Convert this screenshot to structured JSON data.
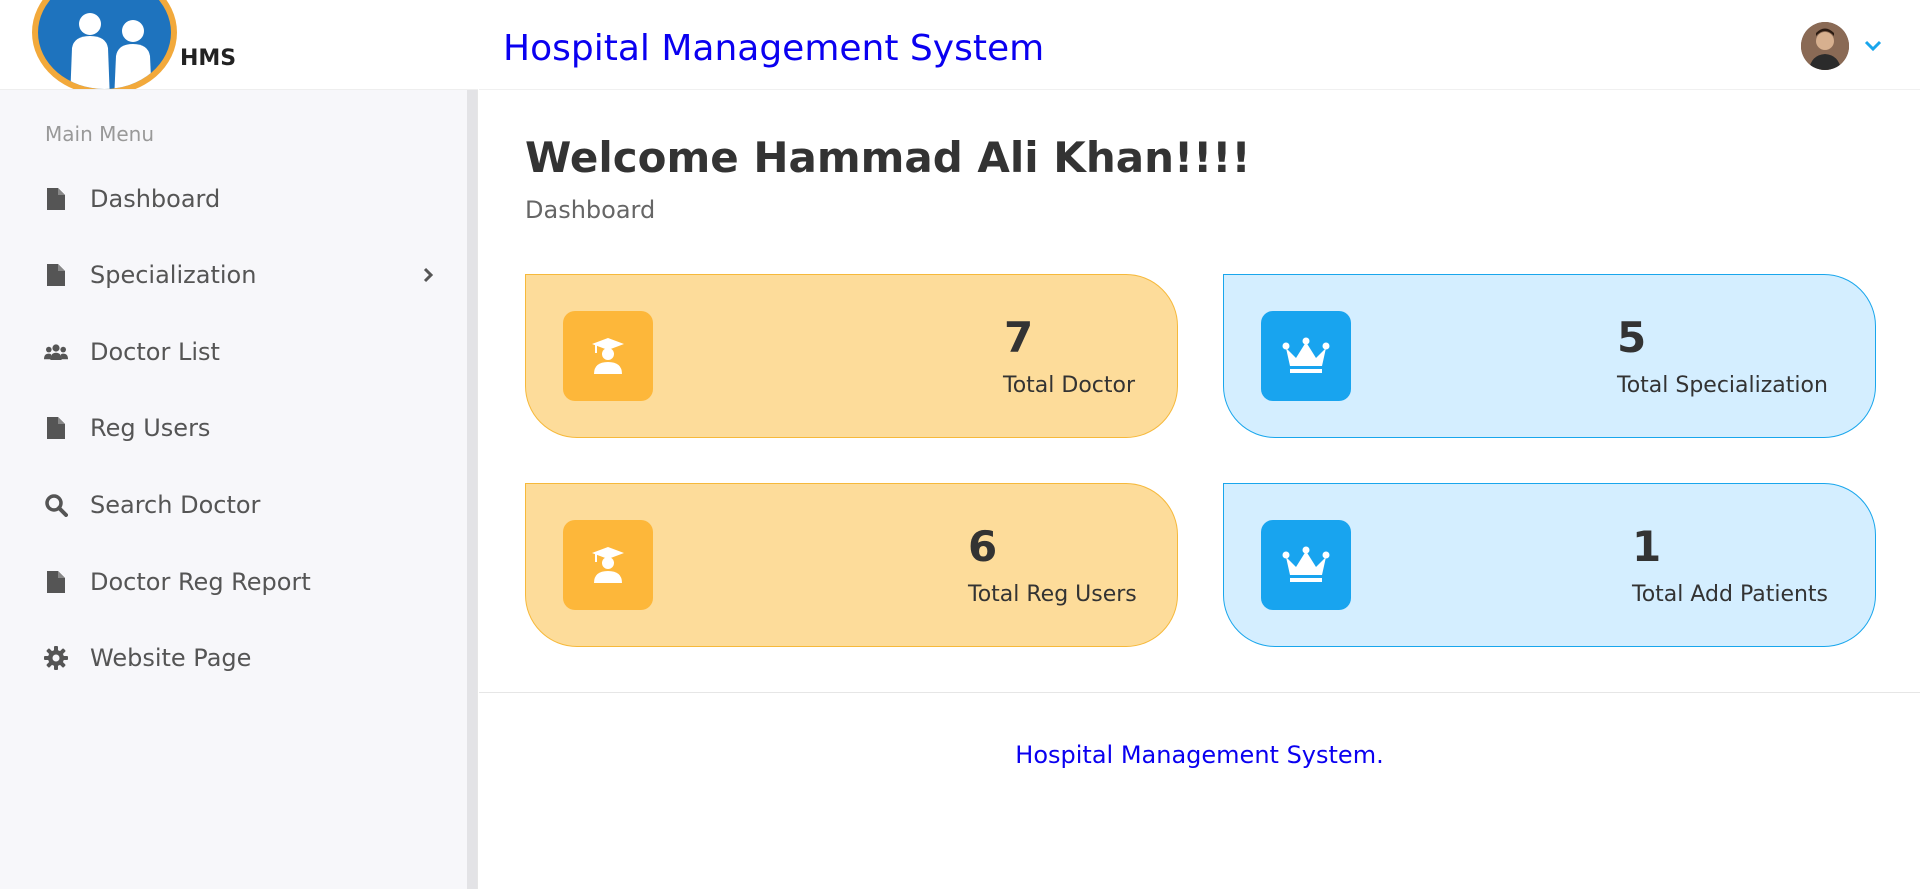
{
  "logo": {
    "text": "HMS",
    "icon": "doctors-logo"
  },
  "sidebar": {
    "section_title": "Main Menu",
    "items": [
      {
        "label": "Dashboard",
        "icon": "file-icon"
      },
      {
        "label": "Specialization",
        "icon": "file-icon",
        "has_submenu": true
      },
      {
        "label": "Doctor List",
        "icon": "users-icon"
      },
      {
        "label": "Reg Users",
        "icon": "file-icon"
      },
      {
        "label": "Search Doctor",
        "icon": "search-icon"
      },
      {
        "label": "Doctor Reg Report",
        "icon": "file-icon"
      },
      {
        "label": "Website Page",
        "icon": "gear-icon"
      }
    ]
  },
  "header": {
    "title": "Hospital Management System"
  },
  "main": {
    "welcome": "Welcome Hammad Ali Khan!!!!",
    "breadcrumb": "Dashboard",
    "cards": [
      {
        "value": "7",
        "label": "Total Doctor",
        "icon": "graduate-icon",
        "color": "#fddc9a"
      },
      {
        "value": "5",
        "label": "Total Specialization",
        "icon": "crown-icon",
        "color": "#d4eeff"
      },
      {
        "value": "6",
        "label": "Total Reg Users",
        "icon": "graduate-icon",
        "color": "#fddc9a"
      },
      {
        "value": "1",
        "label": "Total Add Patients",
        "icon": "crown-icon",
        "color": "#d4eeff"
      }
    ]
  },
  "footer": {
    "text": "Hospital Management System."
  },
  "colors": {
    "brand_blue": "#0a00f0",
    "accent_yellow": "#fdb73a",
    "accent_blue": "#18a4ef"
  }
}
